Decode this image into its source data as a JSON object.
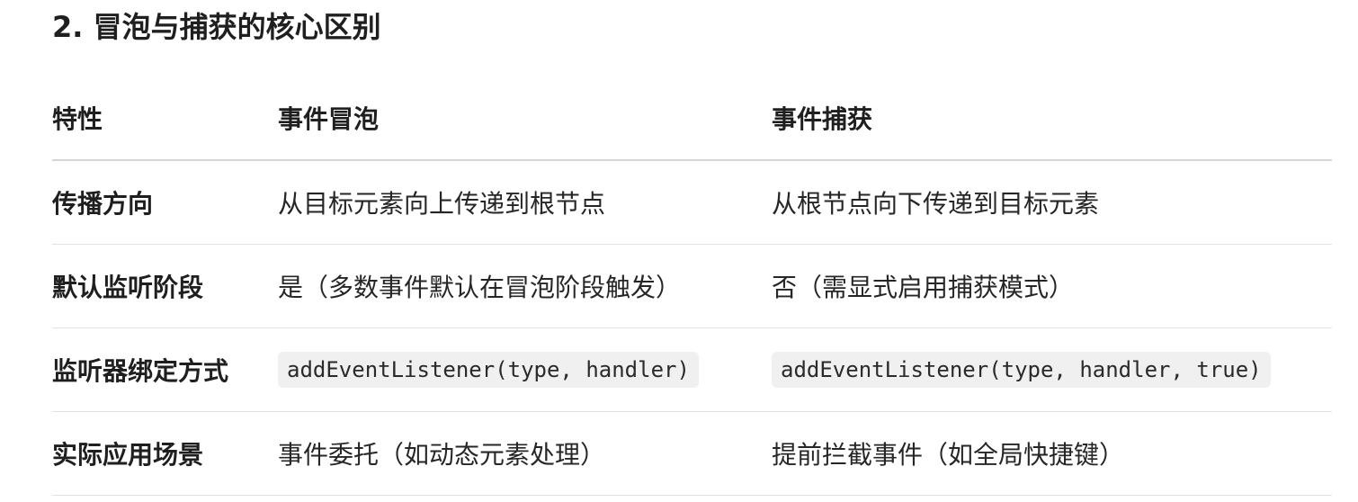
{
  "section": {
    "title": "2. 冒泡与捕获的核心区别"
  },
  "table": {
    "headers": [
      "特性",
      "事件冒泡",
      "事件捕获"
    ],
    "rows": [
      {
        "label": "传播方向",
        "bubbling": "从目标元素向上传递到根节点",
        "capturing": "从根节点向下传递到目标元素"
      },
      {
        "label": "默认监听阶段",
        "bubbling": "是（多数事件默认在冒泡阶段触发）",
        "capturing": "否（需显式启用捕获模式）"
      },
      {
        "label": "监听器绑定方式",
        "bubbling": "addEventListener(type, handler)",
        "capturing": "addEventListener(type, handler, true)"
      },
      {
        "label": "实际应用场景",
        "bubbling": "事件委托（如动态元素处理）",
        "capturing": "提前拦截事件（如全局快捷键）"
      }
    ]
  }
}
